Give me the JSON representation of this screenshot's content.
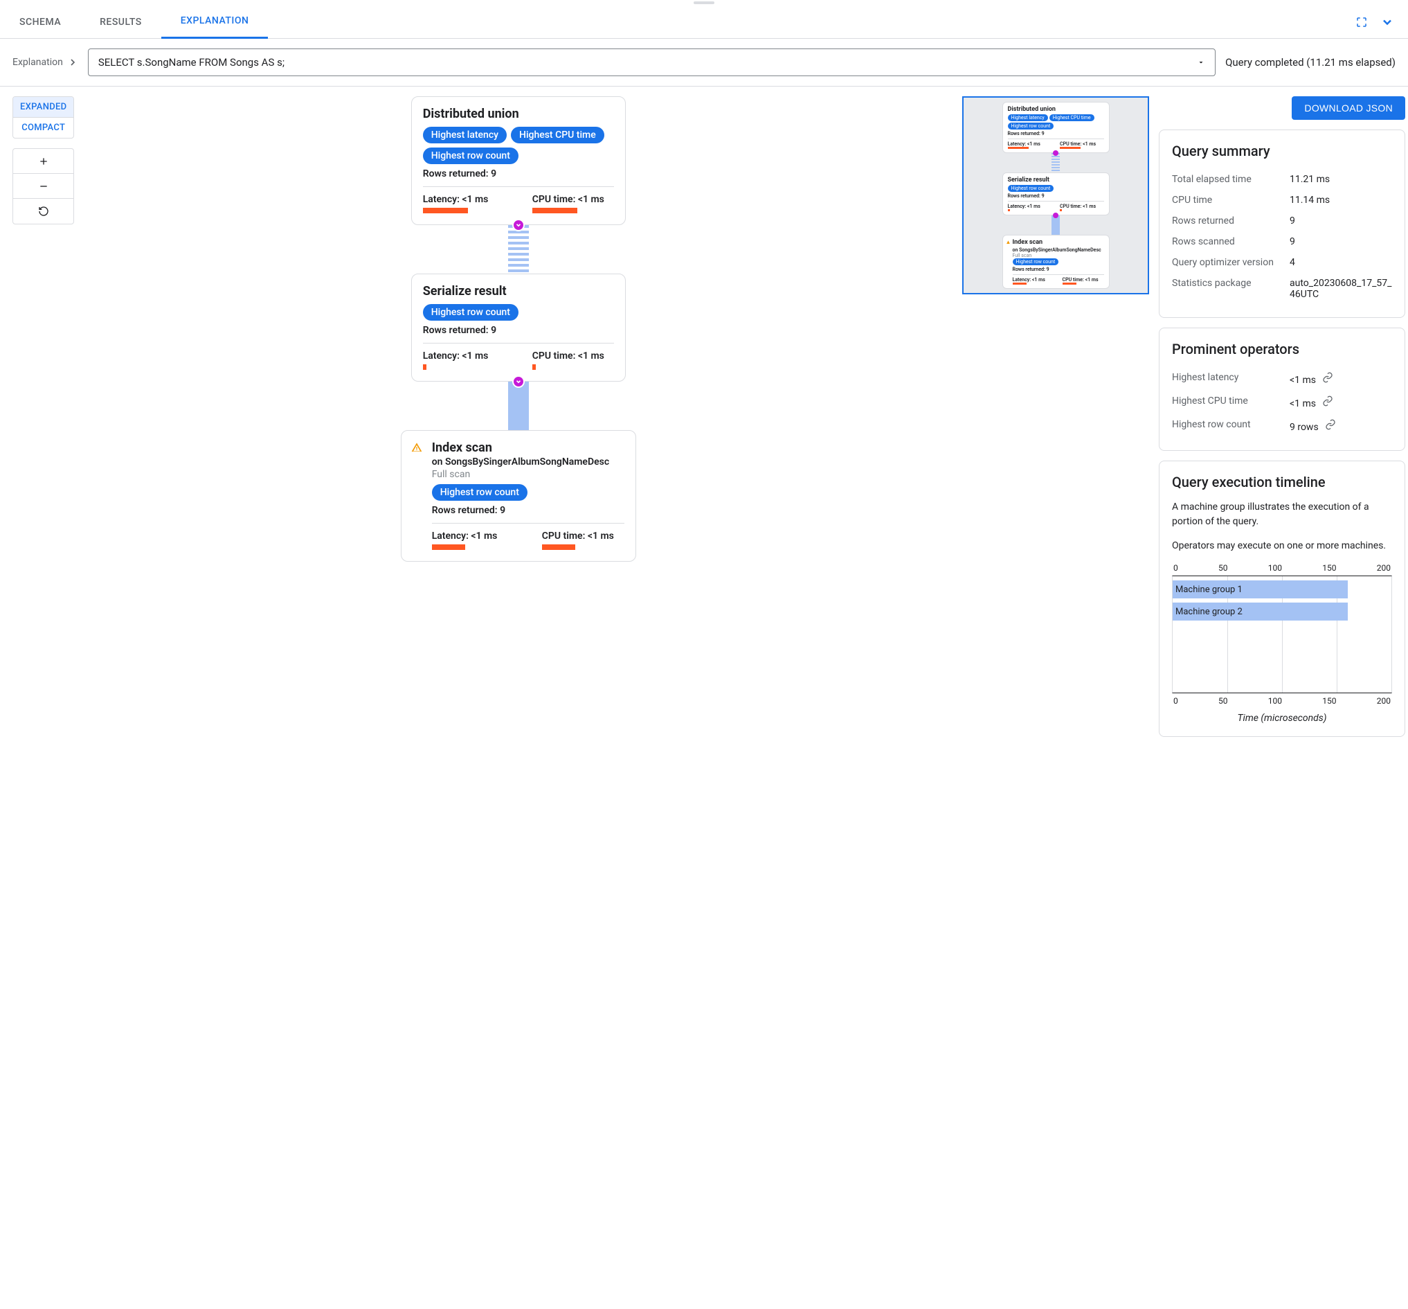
{
  "tabs": {
    "schema": "SCHEMA",
    "results": "RESULTS",
    "explanation": "EXPLANATION"
  },
  "breadcrumb": "Explanation",
  "query": "SELECT s.SongName FROM Songs AS s;",
  "status": "Query completed (11.21 ms elapsed)",
  "view": {
    "expanded": "EXPANDED",
    "compact": "COMPACT"
  },
  "download": "DOWNLOAD JSON",
  "nodes": {
    "n1": {
      "title": "Distributed union",
      "p1": "Highest latency",
      "p2": "Highest CPU time",
      "p3": "Highest row count",
      "rows": "Rows returned: 9",
      "lat": "Latency: <1 ms",
      "cpu": "CPU time: <1 ms"
    },
    "n2": {
      "title": "Serialize result",
      "p1": "Highest row count",
      "rows": "Rows returned: 9",
      "lat": "Latency: <1 ms",
      "cpu": "CPU time: <1 ms"
    },
    "n3": {
      "title": "Index scan",
      "on": "on SongsBySingerAlbumSongNameDesc",
      "full": "Full scan",
      "p1": "Highest row count",
      "rows": "Rows returned: 9",
      "lat": "Latency: <1 ms",
      "cpu": "CPU time: <1 ms"
    }
  },
  "summary": {
    "title": "Query summary",
    "rows": {
      "elapsed_k": "Total elapsed time",
      "elapsed_v": "11.21 ms",
      "cpu_k": "CPU time",
      "cpu_v": "11.14 ms",
      "ret_k": "Rows returned",
      "ret_v": "9",
      "scan_k": "Rows scanned",
      "scan_v": "9",
      "opt_k": "Query optimizer version",
      "opt_v": "4",
      "stat_k": "Statistics package",
      "stat_v": "auto_20230608_17_57_46UTC"
    }
  },
  "prominent": {
    "title": "Prominent operators",
    "lat_k": "Highest latency",
    "lat_v": "<1 ms",
    "cpu_k": "Highest CPU time",
    "cpu_v": "<1 ms",
    "row_k": "Highest row count",
    "row_v": "9 rows"
  },
  "timeline": {
    "title": "Query execution timeline",
    "desc1": "A machine group illustrates the execution of a portion of the query.",
    "desc2": "Operators may execute on one or more machines.",
    "xlabel": "Time (microseconds)",
    "ticks": {
      "t0": "0",
      "t1": "50",
      "t2": "100",
      "t3": "150",
      "t4": "200"
    },
    "g1": "Machine group 1",
    "g2": "Machine group 2"
  },
  "chart_data": {
    "type": "bar",
    "orientation": "horizontal",
    "title": "Query execution timeline",
    "xlabel": "Time (microseconds)",
    "ylabel": "",
    "xlim": [
      0,
      200
    ],
    "categories": [
      "Machine group 1",
      "Machine group 2"
    ],
    "values": [
      160,
      160
    ]
  }
}
